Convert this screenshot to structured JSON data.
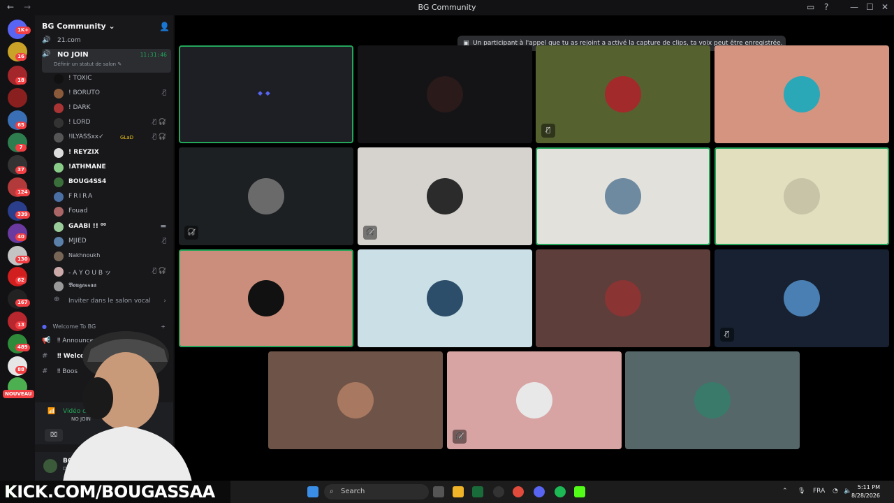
{
  "titlebar": {
    "title": "BG Community",
    "back": "←",
    "forward": "→"
  },
  "rail": {
    "badges": [
      "1K+",
      "16",
      "18",
      "65",
      "7",
      "37",
      "124",
      "339",
      "40",
      "130",
      "62",
      "167",
      "13",
      "489",
      "88"
    ],
    "new_label": "NOUVEAU"
  },
  "sidebar": {
    "server_name": "BG Community ⌄",
    "channels_top": [
      {
        "label": "21.com"
      }
    ],
    "active_channel": {
      "label": "NO JOIN",
      "timer": "11:31:46",
      "status": "Définir un statut de salon ✎"
    },
    "users": [
      {
        "name": "! TOXIC",
        "icons": ""
      },
      {
        "name": "! BORUTO",
        "icons": "🎙̸"
      },
      {
        "name": "! DARK",
        "icons": ""
      },
      {
        "name": "! LORD",
        "icons": "🎙̸ 🎧̸"
      },
      {
        "name": "!ILYASSxx✓",
        "tag": "GLaD",
        "icons": "🎙̸ 🎧̸"
      },
      {
        "name": "! REYZIX",
        "icons": ""
      },
      {
        "name": "!ATHMANE",
        "icons": ""
      },
      {
        "name": "BOUG4SS4",
        "icons": ""
      },
      {
        "name": "FRIRA",
        "icons": ""
      },
      {
        "name": "Fouad",
        "icons": ""
      },
      {
        "name": "GAABI !! ⁰⁰",
        "icons": "▬"
      },
      {
        "name": "MJIED",
        "icons": "🎙̸"
      },
      {
        "name": "Nakhnoukh",
        "icons": ""
      },
      {
        "name": "- A Y O U B ッ",
        "icons": "🎙̸ 🎧̸"
      },
      {
        "name": "𝕭𝖔𝖚𝖌𝖆𝖘𝖘𝖆𝖆",
        "icons": ""
      }
    ],
    "invite_voice": "Inviter dans le salon vocal",
    "category": "Welcome To BG",
    "channels_bottom": [
      {
        "label": "‼ Announcem"
      },
      {
        "label": "‼ Welcom"
      },
      {
        "label": "‼ Boos"
      }
    ],
    "voice_status": "Vidéo conn",
    "voice_channel": "NO JOIN",
    "user_name": "BOUG",
    "user_sub": "Dar"
  },
  "main": {
    "notice": "Un participant à l'appel que tu as rejoint a activé la capture de clips, ta voix peut être enregistrée.",
    "tiles": [
      {
        "bg": "#1e1f24",
        "avatar": "#1e1f24",
        "speaking": true,
        "dots": true,
        "mute": ""
      },
      {
        "bg": "#141416",
        "avatar": "#2a1a1a",
        "speaking": false,
        "mute": ""
      },
      {
        "bg": "#566130",
        "avatar": "#a32a2a",
        "speaking": false,
        "mute": "🎙̸"
      },
      {
        "bg": "#d49480",
        "avatar": "#2aa8b8",
        "speaking": false,
        "mute": ""
      },
      {
        "bg": "#1d2023",
        "avatar": "#6a6a6a",
        "speaking": false,
        "mute": "🎧̸"
      },
      {
        "bg": "#d6d3cf",
        "avatar": "#2b2b2b",
        "speaking": false,
        "mute": "🎧̸"
      },
      {
        "bg": "#e3e1db",
        "avatar": "#6e8aa0",
        "speaking": true,
        "mute": ""
      },
      {
        "bg": "#e2dfbe",
        "avatar": "#c8c4a8",
        "speaking": true,
        "mute": ""
      },
      {
        "bg": "#cc8e7c",
        "avatar": "#111111",
        "speaking": true,
        "mute": ""
      },
      {
        "bg": "#cadfe6",
        "avatar": "#2d4e6a",
        "speaking": false,
        "mute": ""
      },
      {
        "bg": "#5e3e3a",
        "avatar": "#8a3434",
        "speaking": false,
        "mute": ""
      },
      {
        "bg": "#172131",
        "avatar": "#4a7fb3",
        "speaking": false,
        "mute": "🎙̸"
      },
      {
        "bg": "#6e5448",
        "avatar": "#a87860",
        "speaking": false,
        "mute": ""
      },
      {
        "bg": "#d7a3a3",
        "avatar": "#e8e8e8",
        "speaking": false,
        "mute": "🎧̸"
      },
      {
        "bg": "#56676a",
        "avatar": "#3a7a6a",
        "speaking": false,
        "mute": ""
      }
    ]
  },
  "banner": {
    "prefix": "K",
    "text": "KICK.COM/BOUGASSAA"
  },
  "taskbar": {
    "search": "Search",
    "lang": "FRA",
    "time": "5:11 PM",
    "date": "8/28/2026"
  }
}
